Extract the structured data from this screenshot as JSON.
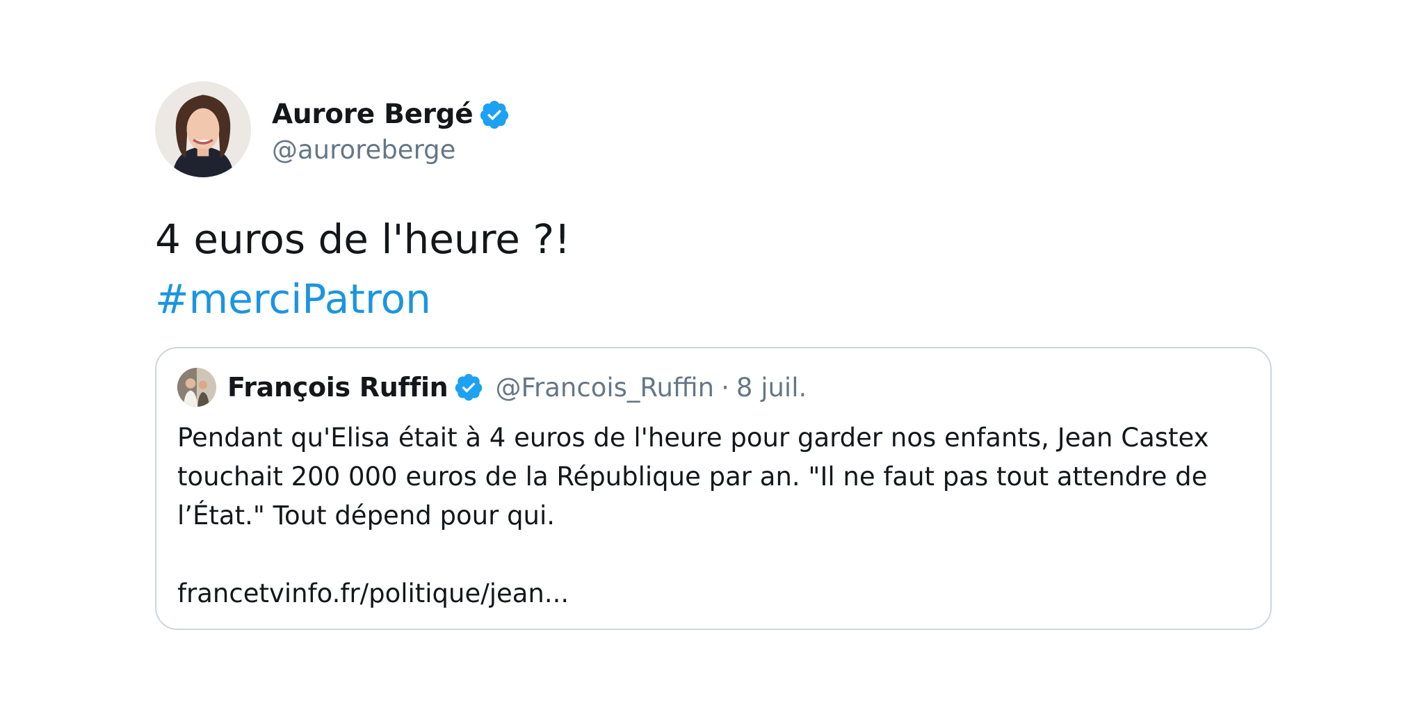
{
  "tweet": {
    "author": {
      "name": "Aurore Bergé",
      "handle": "@auroreberge",
      "verified": true
    },
    "text_line1": "4 euros de l'heure ?!",
    "hashtag": "#merciPatron"
  },
  "quoted_tweet": {
    "author": {
      "name": "François Ruffin",
      "handle": "@Francois_Ruffin",
      "verified": true
    },
    "separator": "·",
    "date": "8 juil.",
    "text_lines": [
      "Pendant qu'Elisa était à 4 euros de l'heure pour garder nos enfants, Jean Castex",
      "touchait 200 000 euros de la République par an. \"Il ne faut pas tout attendre de",
      "l’État.\" Tout dépend pour qui."
    ],
    "link": "francetvinfo.fr/politique/jean..."
  },
  "colors": {
    "verified_badge": "#1da1f2",
    "hashtag": "#1b95e0",
    "secondary_text": "#657786",
    "border": "#ccd6dd"
  },
  "icons": {
    "verified": "verified-badge-icon"
  }
}
